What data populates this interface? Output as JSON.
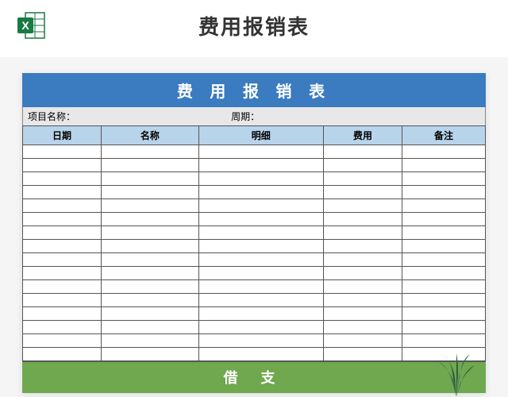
{
  "header": {
    "title": "费用报销表",
    "icon_name": "excel-icon"
  },
  "sheet": {
    "banner": "费 用 报 销 表",
    "meta": {
      "project_label": "项目名称：",
      "period_label": "周期："
    },
    "columns": [
      "日期",
      "名称",
      "明细",
      "费用",
      "备注"
    ],
    "rows": 16,
    "footer": "借  支"
  },
  "colors": {
    "banner": "#3b7bbf",
    "th": "#b8d4ea",
    "footer": "#6fa84f"
  }
}
